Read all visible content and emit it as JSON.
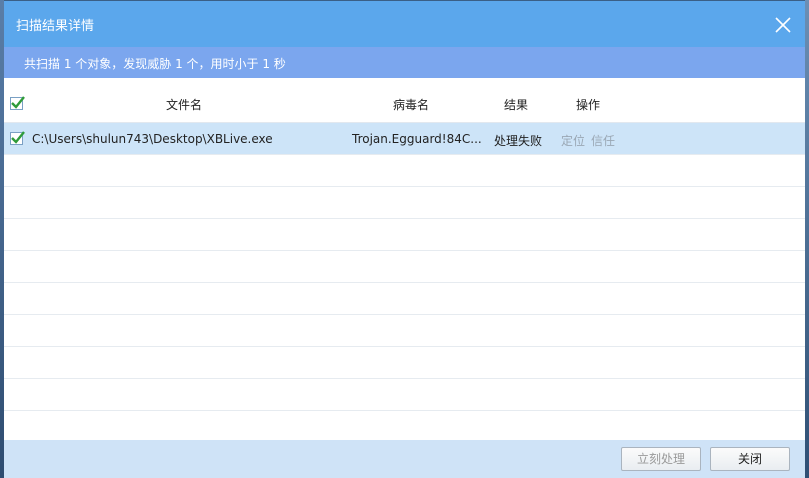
{
  "window": {
    "title": "扫描结果详情"
  },
  "summary": {
    "text": "共扫描 1 个对象，发现威胁 1 个，用时小于 1 秒"
  },
  "table": {
    "headers": {
      "file": "文件名",
      "virus": "病毒名",
      "result": "结果",
      "action": "操作"
    },
    "rows": [
      {
        "checked": true,
        "file": "C:\\Users\\shulun743\\Desktop\\XBLive.exe",
        "virus": "Trojan.Egguard!84C...",
        "result": "处理失败",
        "locate": "定位",
        "trust": "信任"
      }
    ]
  },
  "footer": {
    "process_now": "立刻处理",
    "close": "关闭"
  },
  "colors": {
    "titlebar": "#5ba7ec",
    "summary_bar": "#7ba6ee",
    "selected_row": "#cde4f8",
    "footer": "#cfe3f7",
    "check_green": "#2f9b3a"
  },
  "icons": {
    "close": "close-icon",
    "check": "checkmark-icon"
  }
}
